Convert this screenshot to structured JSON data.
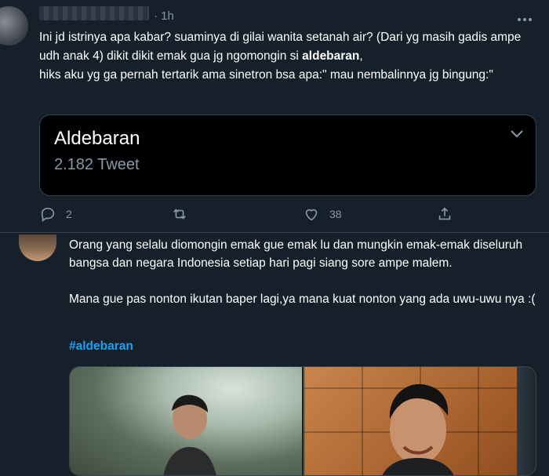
{
  "tweet1": {
    "time": "· 1h",
    "text_before": "Ini jd istrinya apa kabar? suaminya di gilai wanita setanah air? (Dari yg masih gadis ampe udh anak 4) dikit dikit emak gua jg ngomongin si ",
    "text_bold": "aldebaran",
    "text_after": ",\nhiks aku yg ga pernah tertarik ama sinetron bsa apa:\" mau nembalinnya jg bingung:\"",
    "card": {
      "title": "Aldebaran",
      "subtitle": "2.182 Tweet"
    },
    "actions": {
      "reply_count": "2",
      "retweet_count": "",
      "like_count": "38"
    }
  },
  "tweet2": {
    "text": "Orang yang selalu diomongin emak gue emak lu dan mungkin emak-emak diseluruh bangsa dan negara Indonesia setiap hari pagi siang sore ampe malem.\n\nMana gue pas nonton ikutan baper lagi,ya mana kuat nonton yang ada uwu-uwu nya :(",
    "hashtag": "#aldebaran"
  },
  "colors": {
    "background": "#15202b",
    "text_primary": "#ffffff",
    "text_secondary": "#8899a6",
    "link": "#1da1f2",
    "border": "#38444d"
  },
  "icons": [
    "more-icon",
    "chevron-down-icon",
    "reply-icon",
    "retweet-icon",
    "like-icon",
    "share-icon"
  ]
}
